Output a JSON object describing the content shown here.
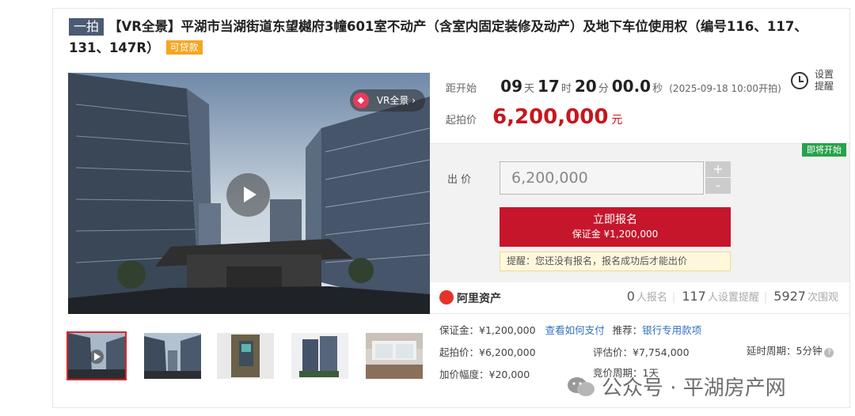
{
  "header": {
    "tag": "一拍",
    "title": "【VR全景】平湖市当湖街道东望樾府3幢601室不动产（含室内固定装修及动产）及地下车位使用权（编号116、117、131、147R）",
    "loan_badge": "可贷款"
  },
  "media": {
    "vr_badge": "VR全景 ›",
    "vr_icon": "vr-icon",
    "play_icon": "play-icon",
    "thumbnails": [
      "thumb-1",
      "thumb-2",
      "thumb-3",
      "thumb-4",
      "thumb-5"
    ],
    "selected_thumbnail": 0
  },
  "countdown": {
    "label": "距开始",
    "days": "09",
    "days_unit": "天",
    "hours": "17",
    "hours_unit": "时",
    "minutes": "20",
    "minutes_unit": "分",
    "seconds": "00.0",
    "seconds_unit": "秒",
    "start_time": "(2025-09-18 10:00开拍)"
  },
  "reminder": {
    "line1": "设置",
    "line2": "提醒"
  },
  "start_price": {
    "label": "起拍价",
    "value": "6,200,000",
    "unit": "元"
  },
  "bid": {
    "status_badge": "即将开始",
    "label": "出 价",
    "input_value": "6,200,000",
    "plus": "+",
    "minus": "-",
    "signup_label": "立即报名",
    "deposit_label": "保证金 ¥1,200,000",
    "tip": "提醒：您还没有报名，报名成功后才能出价"
  },
  "stats": {
    "brand": "阿里资产",
    "signups": "0",
    "signups_label": "人报名",
    "reminders": "117",
    "reminders_label": "人设置提醒",
    "views": "5927",
    "views_label": "次围观"
  },
  "details": {
    "deposit": "保证金：¥1,200,000",
    "how_pay": "查看如何支付",
    "recommend_label": "推荐：",
    "recommend_link": "银行专用款项",
    "start_price": "起拍价：¥6,200,000",
    "appraisal": "评估价：¥7,754,000",
    "delay": "延时周期：5分钟",
    "increment": "加价幅度：¥20,000",
    "bid_cycle": "竞价周期：1天"
  },
  "watermark": "公众号 · 平湖房产网",
  "colors": {
    "accent_red": "#c8161d",
    "green_badge": "#27a34a",
    "link_blue": "#2f6fbf",
    "tag_bg": "#4b5b73",
    "loan_orange": "#f5a623"
  }
}
